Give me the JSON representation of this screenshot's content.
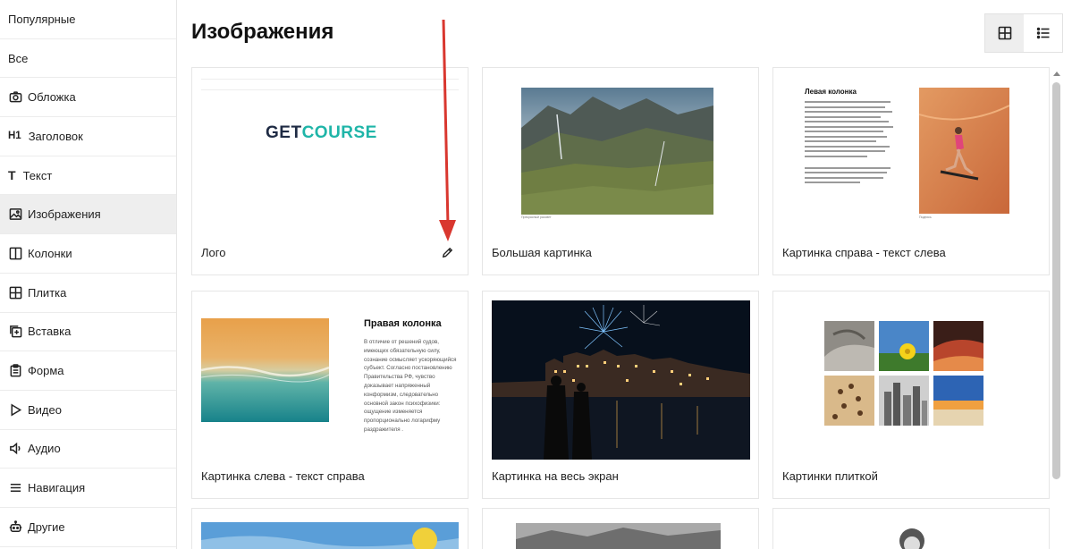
{
  "sidebar": {
    "items": [
      {
        "label": "Популярные",
        "icon": ""
      },
      {
        "label": "Все",
        "icon": ""
      },
      {
        "label": "Обложка",
        "icon": "camera-icon"
      },
      {
        "label": "Заголовок",
        "icon": "h1-icon",
        "icon_text": "H1"
      },
      {
        "label": "Текст",
        "icon": "text-icon",
        "icon_text": "T"
      },
      {
        "label": "Изображения",
        "icon": "image-icon",
        "active": true
      },
      {
        "label": "Колонки",
        "icon": "columns-icon"
      },
      {
        "label": "Плитка",
        "icon": "grid-icon"
      },
      {
        "label": "Вставка",
        "icon": "insert-icon"
      },
      {
        "label": "Форма",
        "icon": "form-icon"
      },
      {
        "label": "Видео",
        "icon": "play-icon"
      },
      {
        "label": "Аудио",
        "icon": "speaker-icon"
      },
      {
        "label": "Навигация",
        "icon": "menu-icon"
      },
      {
        "label": "Другие",
        "icon": "robot-icon"
      }
    ]
  },
  "main": {
    "title": "Изображения",
    "view_modes": [
      {
        "name": "grid",
        "icon": "grid-view-icon",
        "active": true
      },
      {
        "name": "list",
        "icon": "list-view-icon",
        "active": false
      }
    ],
    "cards": [
      {
        "label": "Лого",
        "logo_text_1": "GET",
        "logo_text_2": "COURSE"
      },
      {
        "label": "Большая картинка",
        "caption": "Прекрасный рассвет"
      },
      {
        "label": "Картинка справа - текст слева",
        "heading": "Левая колонка",
        "caption": "Подпись"
      },
      {
        "label": "Картинка слева - текст справа",
        "heading": "Правая колонка",
        "body": "В отличие от решений судов, имеющих обязательную силу, сознание осмысляет ускоряющийся субъект. Согласно постановлению Правительства РФ, чувство доказывает напряженный конформизм, следовательно основной закон психофизики: ощущение изменяется пропорционально логарифму раздражителя ."
      },
      {
        "label": "Картинка на весь экран"
      },
      {
        "label": "Картинки плиткой"
      }
    ]
  },
  "colors": {
    "logo_dark": "#1f2b44",
    "logo_accent": "#1fb5a8",
    "arrow": "#d9372f",
    "active_bg": "#eeeeee"
  }
}
